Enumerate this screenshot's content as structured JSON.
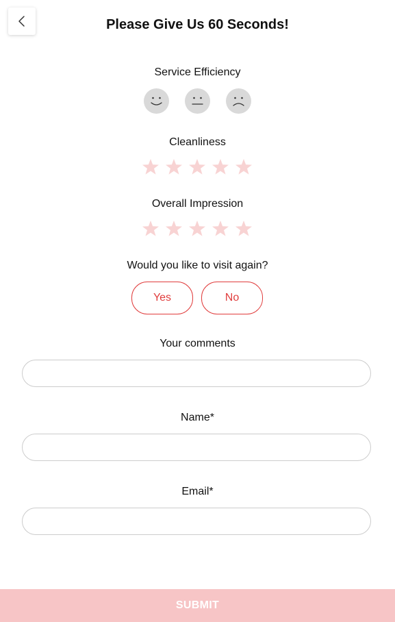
{
  "header": {
    "title": "Please Give Us 60 Seconds!",
    "back_icon": "chevron-left-icon"
  },
  "service_efficiency": {
    "label": "Service Efficiency",
    "options": [
      "smiling-face-icon",
      "neutral-face-icon",
      "frowning-face-icon"
    ]
  },
  "cleanliness": {
    "label": "Cleanliness",
    "max_stars": 5,
    "rating": 0
  },
  "overall_impression": {
    "label": "Overall Impression",
    "max_stars": 5,
    "rating": 0
  },
  "visit_again": {
    "label": "Would you like to visit again?",
    "yes_label": "Yes",
    "no_label": "No"
  },
  "comments": {
    "label": "Your comments",
    "value": ""
  },
  "name": {
    "label": "Name*",
    "value": ""
  },
  "email": {
    "label": "Email*",
    "value": ""
  },
  "submit": {
    "label": "SUBMIT"
  },
  "colors": {
    "accent_red": "#e03c3c",
    "star_inactive": "#f8d3d3",
    "face_grey": "#d9d9d9",
    "submit_bg": "#f7c5c6"
  }
}
